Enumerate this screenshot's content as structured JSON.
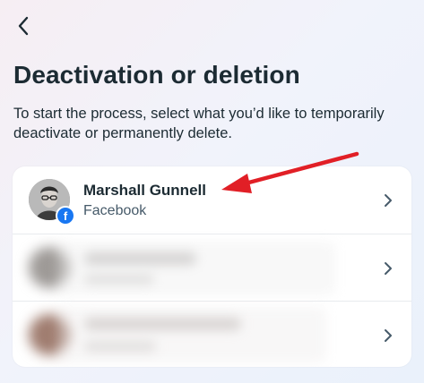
{
  "header": {
    "back_icon": "chevron-left-icon"
  },
  "page": {
    "title": "Deactivation or deletion",
    "description": "To start the process, select what you’d like to temporarily deactivate or permanently delete."
  },
  "accounts": [
    {
      "name": "Marshall Gunnell",
      "platform": "Facebook",
      "badge_icon": "facebook-icon",
      "badge_glyph": "f"
    }
  ],
  "colors": {
    "facebook_blue": "#1877f2",
    "annotation_arrow": "#e11f26"
  }
}
